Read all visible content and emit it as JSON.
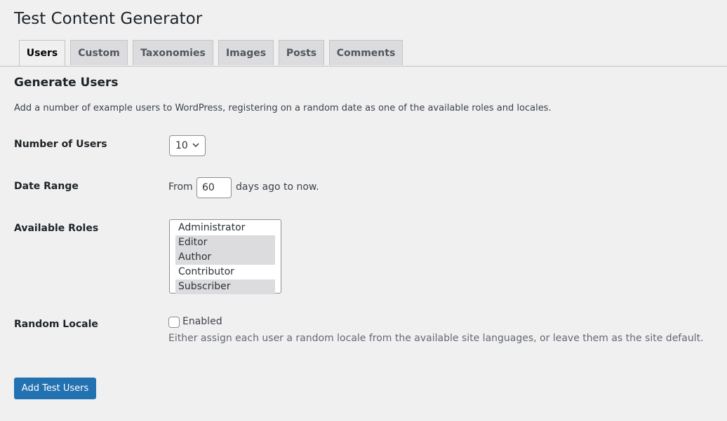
{
  "page": {
    "title": "Test Content Generator"
  },
  "tabs": [
    {
      "label": "Users",
      "active": true
    },
    {
      "label": "Custom",
      "active": false
    },
    {
      "label": "Taxonomies",
      "active": false
    },
    {
      "label": "Images",
      "active": false
    },
    {
      "label": "Posts",
      "active": false
    },
    {
      "label": "Comments",
      "active": false
    }
  ],
  "section": {
    "title": "Generate Users",
    "description": "Add a number of example users to WordPress, registering on a random date as one of the available roles and locales."
  },
  "form": {
    "number_of_users": {
      "label": "Number of Users",
      "value": "10"
    },
    "date_range": {
      "label": "Date Range",
      "prefix": "From",
      "value": "60",
      "suffix": "days ago to now."
    },
    "available_roles": {
      "label": "Available Roles",
      "options": [
        {
          "label": "Administrator",
          "selected": false
        },
        {
          "label": "Editor",
          "selected": true
        },
        {
          "label": "Author",
          "selected": true
        },
        {
          "label": "Contributor",
          "selected": false
        },
        {
          "label": "Subscriber",
          "selected": true
        }
      ]
    },
    "random_locale": {
      "label": "Random Locale",
      "checkbox_label": "Enabled",
      "checked": false,
      "help": "Either assign each user a random locale from the available site languages, or leave them as the site default."
    },
    "submit_label": "Add Test Users"
  },
  "colors": {
    "primary": "#2271b1",
    "background": "#f0f0f1",
    "tab_inactive": "#dcdcde"
  }
}
